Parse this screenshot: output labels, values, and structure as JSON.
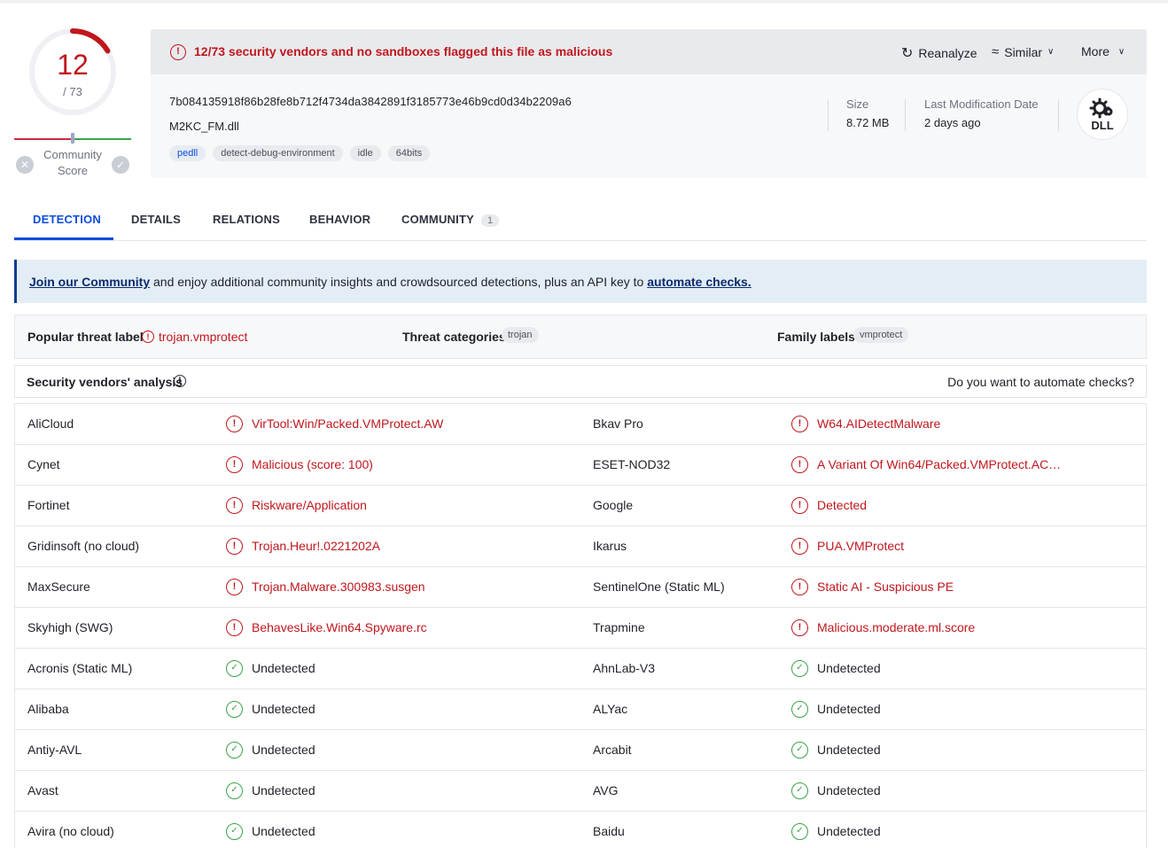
{
  "score": {
    "detected": "12",
    "total": "/ 73",
    "detected_fraction": 0.164,
    "community_label": "Community Score",
    "community_fraction": 0.5
  },
  "header": {
    "alert": "12/73 security vendors and no sandboxes flagged this file as malicious",
    "reanalyze": "Reanalyze",
    "similar": "Similar",
    "more": "More",
    "hash": "7b084135918f86b28fe8b712f4734da3842891f3185773e46b9cd0d34b2209a6",
    "filename": "M2KC_FM.dll",
    "tags": [
      "pedll",
      "detect-debug-environment",
      "idle",
      "64bits"
    ],
    "size_label": "Size",
    "size_value": "8.72 MB",
    "lastmod_label": "Last Modification Date",
    "lastmod_value": "2 days ago",
    "filetype_badge": "DLL"
  },
  "tabs": [
    {
      "label": "DETECTION",
      "active": true
    },
    {
      "label": "DETAILS"
    },
    {
      "label": "RELATIONS"
    },
    {
      "label": "BEHAVIOR"
    },
    {
      "label": "COMMUNITY",
      "count": "1"
    }
  ],
  "banner": {
    "link1": "Join our Community",
    "middle": " and enjoy additional community insights and crowdsourced detections, plus an API key to ",
    "link2": "automate checks."
  },
  "threat": {
    "popular_label": "Popular threat label",
    "popular_value": "trojan.vmprotect",
    "categories_label": "Threat categories",
    "categories_value": "trojan",
    "family_label": "Family labels",
    "family_value": "vmprotect"
  },
  "vendors_header": {
    "title": "Security vendors' analysis",
    "right": "Do you want to automate checks?"
  },
  "vendors": [
    [
      {
        "name": "AliCloud",
        "result": "VirTool:Win/Packed.VMProtect.AW",
        "malicious": true
      },
      {
        "name": "Bkav Pro",
        "result": "W64.AIDetectMalware",
        "malicious": true
      }
    ],
    [
      {
        "name": "Cynet",
        "result": "Malicious (score: 100)",
        "malicious": true
      },
      {
        "name": "ESET-NOD32",
        "result": "A Variant Of Win64/Packed.VMProtect.AC…",
        "malicious": true
      }
    ],
    [
      {
        "name": "Fortinet",
        "result": "Riskware/Application",
        "malicious": true
      },
      {
        "name": "Google",
        "result": "Detected",
        "malicious": true
      }
    ],
    [
      {
        "name": "Gridinsoft (no cloud)",
        "result": "Trojan.Heur!.0221202A",
        "malicious": true
      },
      {
        "name": "Ikarus",
        "result": "PUA.VMProtect",
        "malicious": true
      }
    ],
    [
      {
        "name": "MaxSecure",
        "result": "Trojan.Malware.300983.susgen",
        "malicious": true
      },
      {
        "name": "SentinelOne (Static ML)",
        "result": "Static AI - Suspicious PE",
        "malicious": true
      }
    ],
    [
      {
        "name": "Skyhigh (SWG)",
        "result": "BehavesLike.Win64.Spyware.rc",
        "malicious": true
      },
      {
        "name": "Trapmine",
        "result": "Malicious.moderate.ml.score",
        "malicious": true
      }
    ],
    [
      {
        "name": "Acronis (Static ML)",
        "result": "Undetected",
        "malicious": false
      },
      {
        "name": "AhnLab-V3",
        "result": "Undetected",
        "malicious": false
      }
    ],
    [
      {
        "name": "Alibaba",
        "result": "Undetected",
        "malicious": false
      },
      {
        "name": "ALYac",
        "result": "Undetected",
        "malicious": false
      }
    ],
    [
      {
        "name": "Antiy-AVL",
        "result": "Undetected",
        "malicious": false
      },
      {
        "name": "Arcabit",
        "result": "Undetected",
        "malicious": false
      }
    ],
    [
      {
        "name": "Avast",
        "result": "Undetected",
        "malicious": false
      },
      {
        "name": "AVG",
        "result": "Undetected",
        "malicious": false
      }
    ],
    [
      {
        "name": "Avira (no cloud)",
        "result": "Undetected",
        "malicious": false
      },
      {
        "name": "Baidu",
        "result": "Undetected",
        "malicious": false
      }
    ]
  ],
  "colors": {
    "malicious": "#c0171d",
    "clean": "#3aa348",
    "accent": "#0b4dda"
  }
}
